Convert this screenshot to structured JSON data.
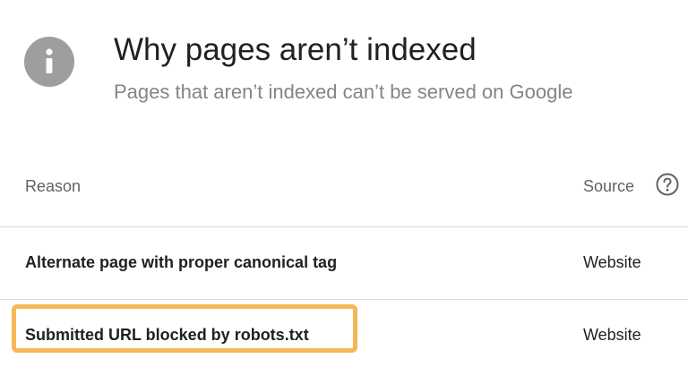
{
  "header": {
    "icon": "info-icon",
    "title": "Why pages aren’t indexed",
    "subtitle": "Pages that aren’t indexed can’t be served on Google"
  },
  "table": {
    "columns": {
      "reason": "Reason",
      "source": "Source",
      "help_icon": "help-icon"
    },
    "rows": [
      {
        "reason": "Alternate page with proper canonical tag",
        "source": "Website",
        "highlighted": false
      },
      {
        "reason": "Submitted URL blocked by robots.txt",
        "source": "Website",
        "highlighted": true
      }
    ]
  },
  "colors": {
    "icon_gray": "#9e9e9e",
    "subtitle_gray": "#80868b",
    "divider": "#dadce0",
    "highlight": "#f6b756"
  }
}
